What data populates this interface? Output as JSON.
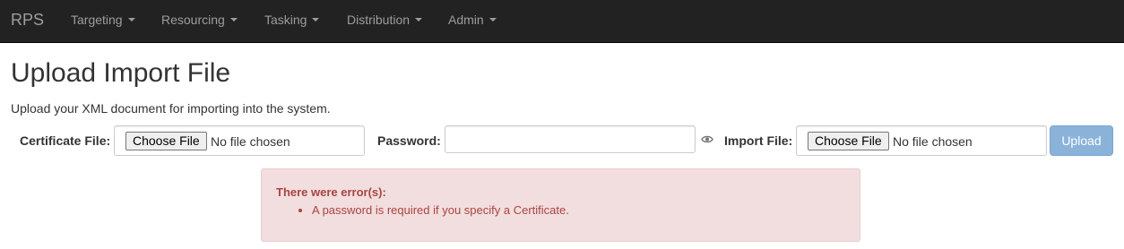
{
  "navbar": {
    "brand": "RPS",
    "items": [
      {
        "label": "Targeting",
        "icon": "caret-down-icon"
      },
      {
        "label": "Resourcing",
        "icon": "caret-down-icon"
      },
      {
        "label": "Tasking",
        "icon": "caret-down-icon"
      },
      {
        "label": "Distribution",
        "icon": "caret-down-icon"
      },
      {
        "label": "Admin",
        "icon": "caret-down-icon"
      }
    ]
  },
  "page": {
    "title": "Upload Import File",
    "subtitle": "Upload your XML document for importing into the system."
  },
  "form": {
    "certificate_label": "Certificate File:",
    "certificate_button": "Choose File",
    "certificate_status": "No file chosen",
    "password_label": "Password:",
    "password_value": "",
    "password_toggle_icon": "eye-icon",
    "import_label": "Import File:",
    "import_button": "Choose File",
    "import_status": "No file chosen",
    "upload_button": "Upload"
  },
  "alert": {
    "title": "There were error(s):",
    "errors": [
      "A password is required if you specify a Certificate."
    ]
  },
  "colors": {
    "navbar_bg": "#222222",
    "nav_text": "#9d9d9d",
    "upload_btn_bg": "#8bb3d9",
    "alert_bg": "#f2dede",
    "alert_border": "#ebccd1",
    "alert_text": "#a94442"
  }
}
